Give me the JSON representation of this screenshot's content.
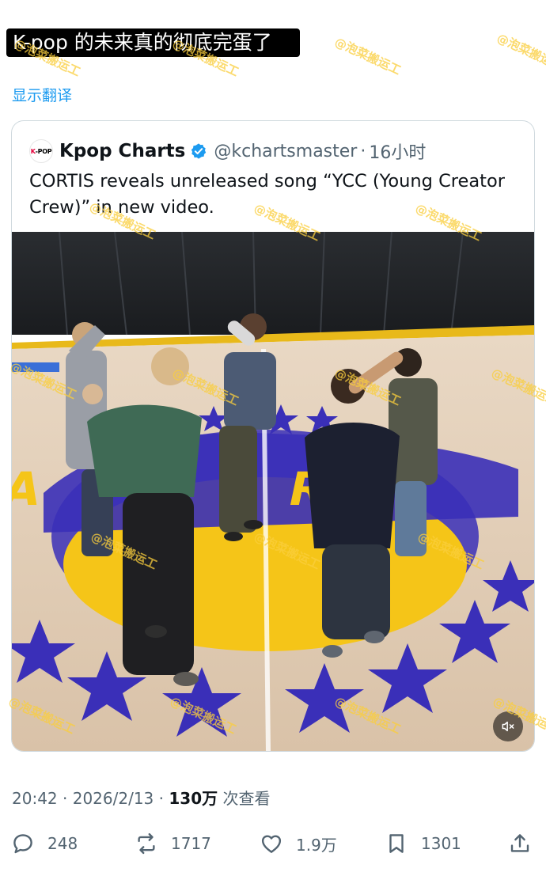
{
  "caption": "K-pop 的未来真的彻底完蛋了",
  "translate_label": "显示翻译",
  "quote": {
    "avatar_text_k": "K",
    "avatar_text_rest": "-POP",
    "display_name": "Kpop Charts",
    "handle": "@kchartsmaster",
    "separator": "·",
    "time_ago": "16小时",
    "text": "CORTIS reveals unreleased song “YCC (Young Creator Crew)” in new video."
  },
  "meta": {
    "time": "20:42",
    "sep1": "·",
    "date": "2026/2/13",
    "sep2": "·",
    "views_count": "130万",
    "views_label": "次查看"
  },
  "actions": {
    "reply_count": "248",
    "repost_count": "1717",
    "like_count": "1.9万",
    "bookmark_count": "1301"
  },
  "watermark_text": "@泡菜搬运工",
  "colors": {
    "accent": "#1d9bf0",
    "text_primary": "#0f1419",
    "text_secondary": "#536471",
    "court_purple": "#3a2fb8",
    "court_gold": "#f5c518"
  }
}
